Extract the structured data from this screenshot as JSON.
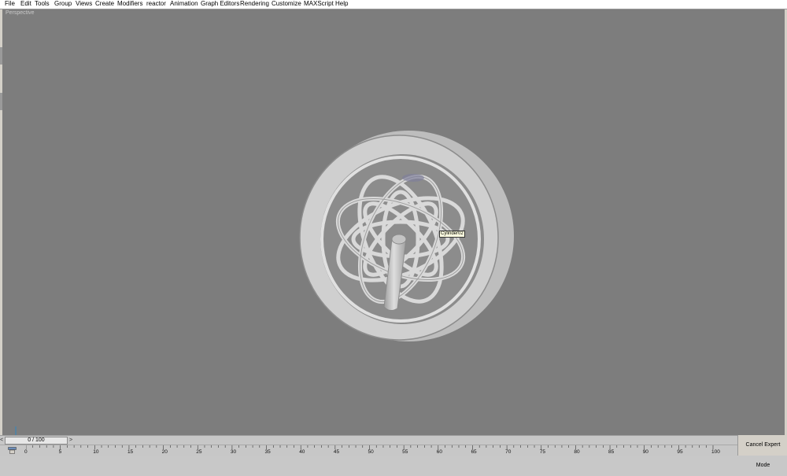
{
  "menu": {
    "items": [
      "File",
      "Edit",
      "Tools",
      "Group",
      "Views",
      "Create",
      "Modifiers",
      "reactor",
      "Animation",
      "Graph Editors",
      "Rendering",
      "Customize",
      "MAXScript",
      "Help"
    ]
  },
  "viewport": {
    "label": "Perspective",
    "background": "#7d7d7d",
    "tooltip": "Cylinder02"
  },
  "timeslider": {
    "position": "0 / 100",
    "left_arrow": "<",
    "right_arrow": ">"
  },
  "trackbar": {
    "ticks": [
      "0",
      "5",
      "10",
      "15",
      "20",
      "25",
      "30",
      "35",
      "40",
      "45",
      "50",
      "55",
      "60",
      "65",
      "70",
      "75",
      "80",
      "85",
      "90",
      "95",
      "100"
    ]
  },
  "status": {
    "cancel_expert_mode": "Cancel Expert Mode"
  }
}
